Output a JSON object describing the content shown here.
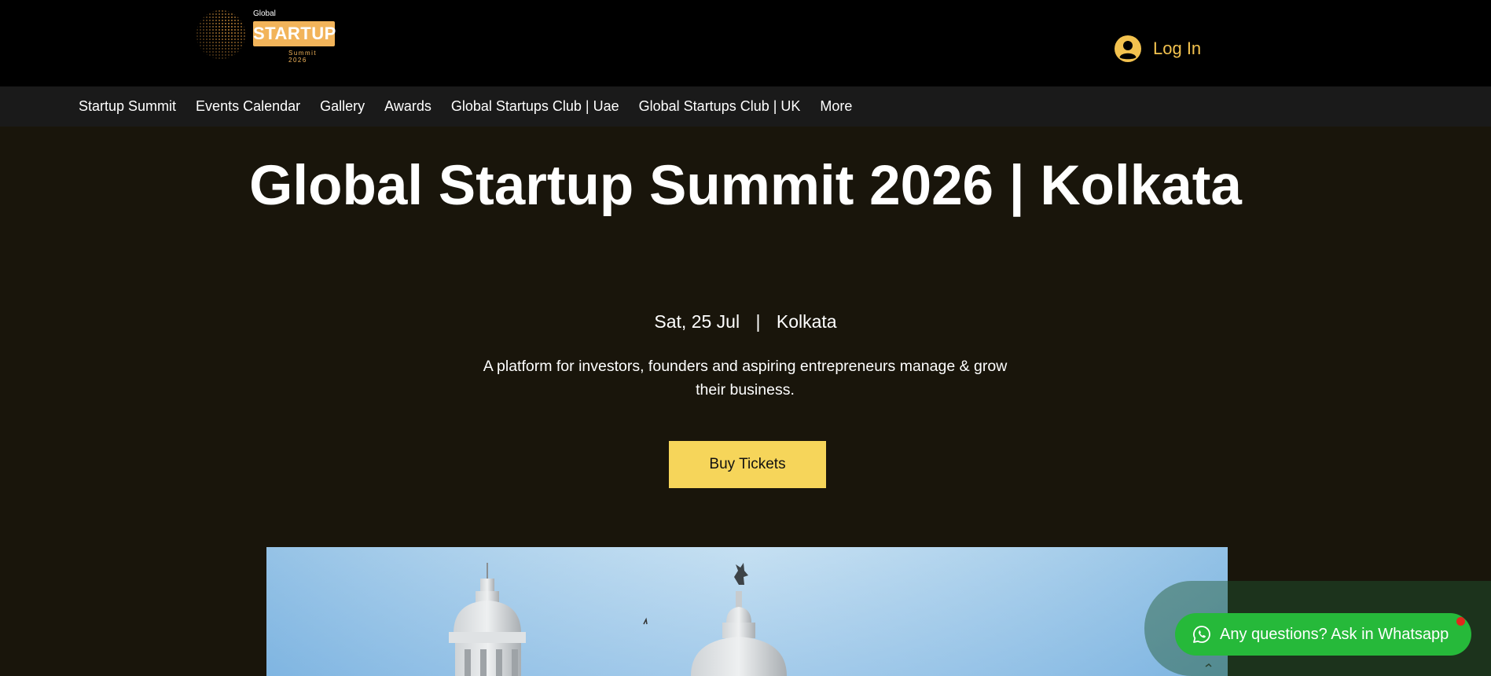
{
  "header": {
    "logo": {
      "small_text": "Global",
      "main_text": "STARTUP",
      "sub_text": "Summit 2026"
    },
    "login_label": "Log In"
  },
  "nav": {
    "items": [
      {
        "label": "Startup Summit"
      },
      {
        "label": "Events Calendar"
      },
      {
        "label": "Gallery"
      },
      {
        "label": "Awards"
      },
      {
        "label": "Global Startups Club | Uae"
      },
      {
        "label": "Global Startups Club | UK"
      },
      {
        "label": "More"
      }
    ]
  },
  "hero": {
    "title": "Global Startup Summit 2026 | Kolkata",
    "date": "Sat, 25 Jul",
    "separator": "|",
    "location": "Kolkata",
    "description": "A platform for investors, founders and aspiring entrepreneurs manage & grow their business.",
    "cta_label": "Buy Tickets"
  },
  "whatsapp": {
    "label": "Any questions? Ask in Whatsapp"
  },
  "colors": {
    "accent_yellow": "#f6d55a",
    "login_yellow": "#f3c24f",
    "logo_orange": "#f2b45a",
    "background": "#19150b",
    "whatsapp_green": "#26b93a",
    "notification_red": "#e1261c"
  },
  "icons": {
    "logo": "globe-dots-icon",
    "login": "user-avatar-icon",
    "whatsapp": "whatsapp-icon"
  }
}
